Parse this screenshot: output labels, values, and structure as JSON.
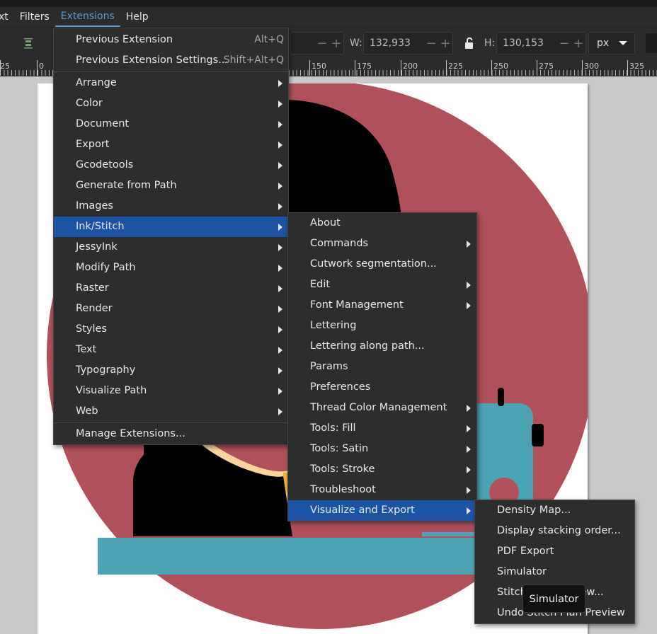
{
  "menubar": {
    "items": [
      {
        "label": "xt"
      },
      {
        "label": "Filters"
      },
      {
        "label": "Extensions",
        "active": true
      },
      {
        "label": "Help"
      }
    ]
  },
  "toolbar": {
    "w_label": "W:",
    "w_value": "132,933",
    "h_label": "H:",
    "h_value": "130,153",
    "unit": "px"
  },
  "ruler": {
    "labels": [
      "25",
      "0",
      "150",
      "175",
      "200",
      "225",
      "250",
      "275",
      "300",
      "325"
    ]
  },
  "extensions_menu": {
    "items": [
      {
        "label": "Previous Extension",
        "accel": "Alt+Q"
      },
      {
        "label": "Previous Extension Settings...",
        "accel": "Shift+Alt+Q"
      },
      {
        "label": "Arrange",
        "submenu": true
      },
      {
        "label": "Color",
        "submenu": true
      },
      {
        "label": "Document",
        "submenu": true
      },
      {
        "label": "Export",
        "submenu": true
      },
      {
        "label": "Gcodetools",
        "submenu": true
      },
      {
        "label": "Generate from Path",
        "submenu": true
      },
      {
        "label": "Images",
        "submenu": true
      },
      {
        "label": "Ink/Stitch",
        "submenu": true,
        "selected": true
      },
      {
        "label": "JessyInk",
        "submenu": true
      },
      {
        "label": "Modify Path",
        "submenu": true
      },
      {
        "label": "Raster",
        "submenu": true
      },
      {
        "label": "Render",
        "submenu": true
      },
      {
        "label": "Styles",
        "submenu": true
      },
      {
        "label": "Text",
        "submenu": true
      },
      {
        "label": "Typography",
        "submenu": true
      },
      {
        "label": "Visualize Path",
        "submenu": true
      },
      {
        "label": "Web",
        "submenu": true
      },
      {
        "label": "Manage Extensions..."
      }
    ]
  },
  "inkstitch_menu": {
    "items": [
      {
        "label": "About"
      },
      {
        "label": "Commands",
        "submenu": true
      },
      {
        "label": "Cutwork segmentation..."
      },
      {
        "label": "Edit",
        "submenu": true
      },
      {
        "label": "Font Management",
        "submenu": true
      },
      {
        "label": "Lettering"
      },
      {
        "label": "Lettering along path..."
      },
      {
        "label": "Params"
      },
      {
        "label": "Preferences"
      },
      {
        "label": "Thread Color Management",
        "submenu": true
      },
      {
        "label": "Tools: Fill",
        "submenu": true
      },
      {
        "label": "Tools: Satin",
        "submenu": true
      },
      {
        "label": "Tools: Stroke",
        "submenu": true
      },
      {
        "label": "Troubleshoot",
        "submenu": true
      },
      {
        "label": "Visualize and Export",
        "submenu": true,
        "selected": true
      }
    ]
  },
  "visualize_menu": {
    "items": [
      {
        "label": "Density Map..."
      },
      {
        "label": "Display stacking order..."
      },
      {
        "label": "PDF Export"
      },
      {
        "label": "Simulator"
      },
      {
        "label": "Stitch Plan Preview..."
      },
      {
        "label": "Undo Stitch Plan Preview"
      }
    ]
  },
  "tooltip": {
    "text": "Simulator"
  },
  "colors": {
    "accent": "#1c53a3",
    "menubar_active": "#5b9bd5",
    "circle": "#b0505a",
    "hair": "#000000",
    "skin": "#fad59b",
    "machine": "#4ba3b4",
    "collar": "#f0b131"
  },
  "icons": [
    "align-icon",
    "lock-open-icon",
    "chevron-right-icon",
    "caret-down-icon"
  ]
}
